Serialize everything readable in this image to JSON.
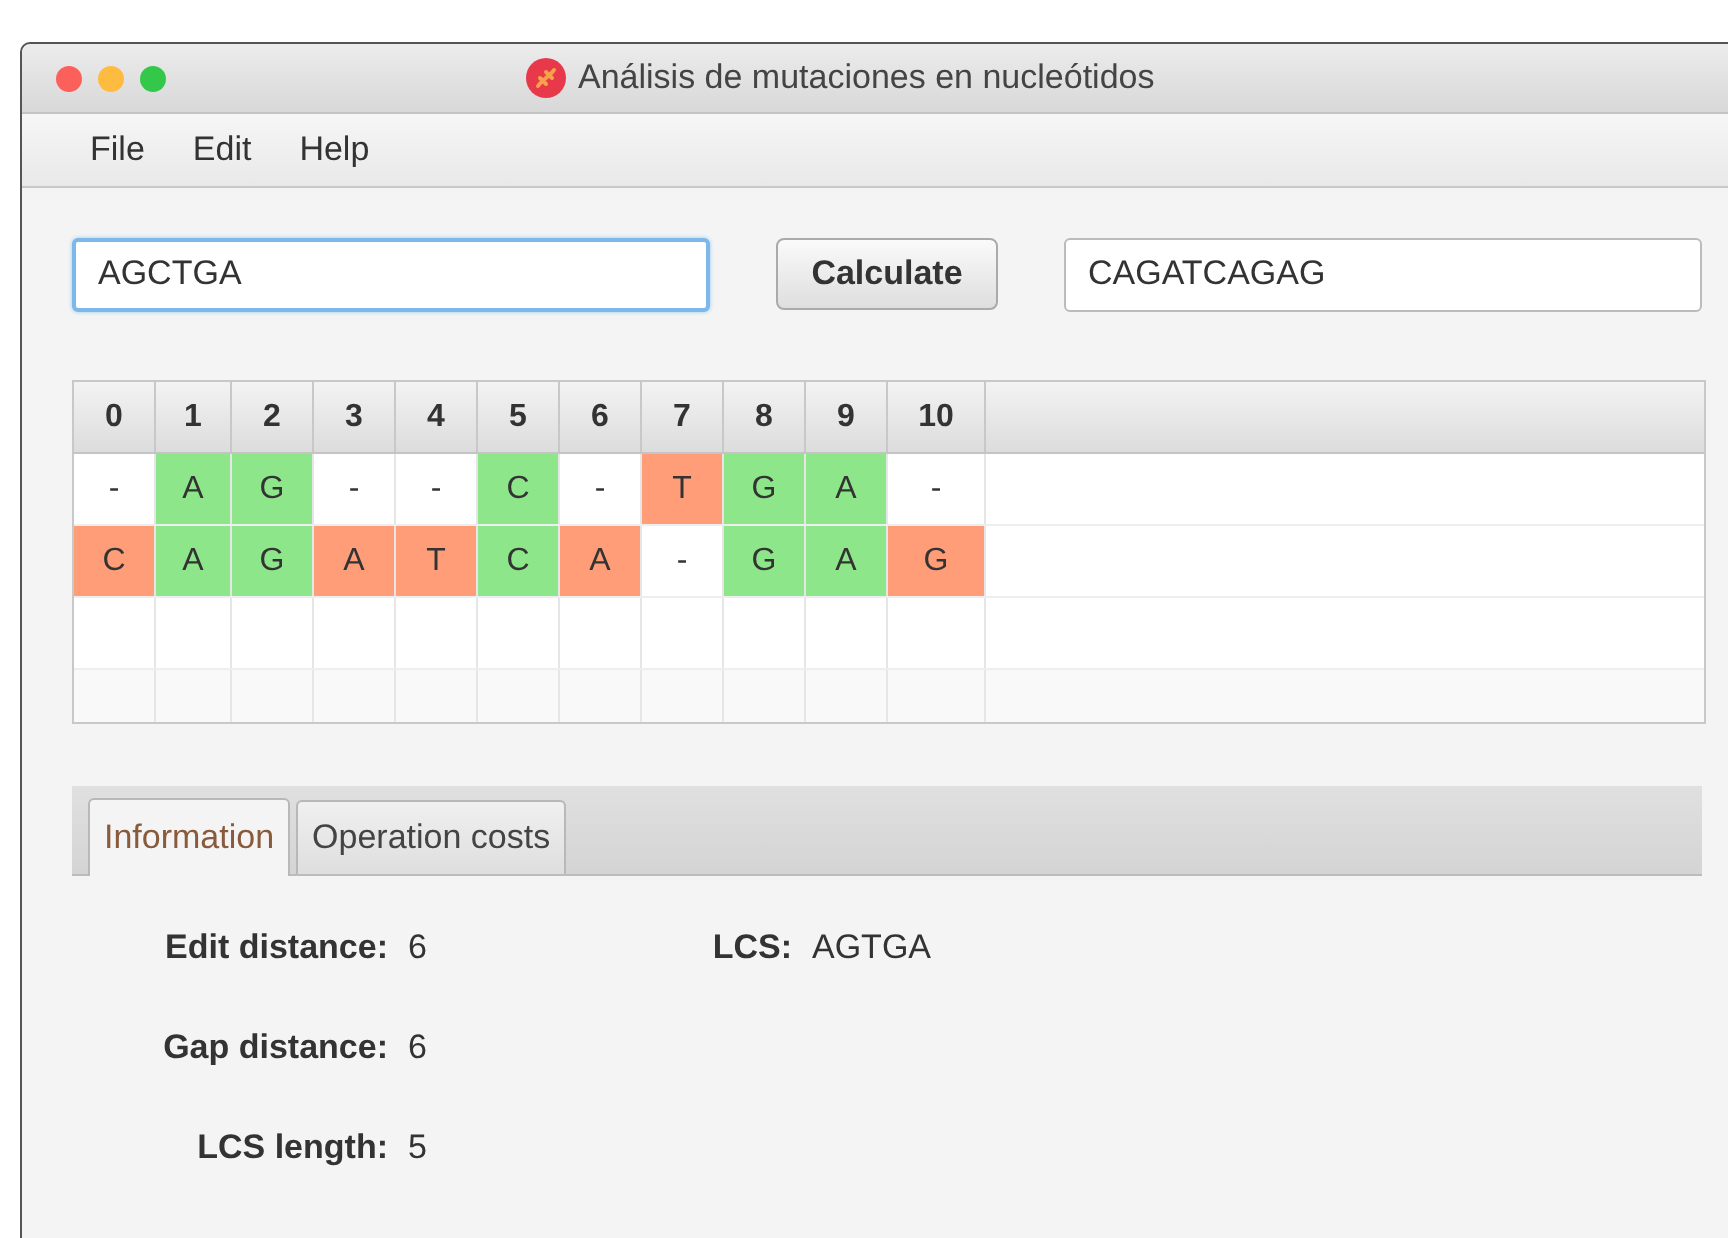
{
  "window": {
    "title": "Análisis de mutaciones en nucleótidos"
  },
  "menu": [
    "File",
    "Edit",
    "Help"
  ],
  "inputs": {
    "left": {
      "value": "AGCTGA",
      "focused": true
    },
    "button": "Calculate",
    "right": {
      "value": "CAGATCAGAG",
      "focused": false
    }
  },
  "table": {
    "columns": [
      "0",
      "1",
      "2",
      "3",
      "4",
      "5",
      "6",
      "7",
      "8",
      "9",
      "10"
    ],
    "rows": [
      [
        {
          "text": "-",
          "kind": "plain"
        },
        {
          "text": "A",
          "kind": "match"
        },
        {
          "text": "G",
          "kind": "match"
        },
        {
          "text": "-",
          "kind": "plain"
        },
        {
          "text": "-",
          "kind": "plain"
        },
        {
          "text": "C",
          "kind": "match"
        },
        {
          "text": "-",
          "kind": "plain"
        },
        {
          "text": "T",
          "kind": "mismatch"
        },
        {
          "text": "G",
          "kind": "match"
        },
        {
          "text": "A",
          "kind": "match"
        },
        {
          "text": "-",
          "kind": "plain"
        }
      ],
      [
        {
          "text": "C",
          "kind": "mismatch"
        },
        {
          "text": "A",
          "kind": "match"
        },
        {
          "text": "G",
          "kind": "match"
        },
        {
          "text": "A",
          "kind": "mismatch"
        },
        {
          "text": "T",
          "kind": "mismatch"
        },
        {
          "text": "C",
          "kind": "match"
        },
        {
          "text": "A",
          "kind": "mismatch"
        },
        {
          "text": "-",
          "kind": "plain"
        },
        {
          "text": "G",
          "kind": "match"
        },
        {
          "text": "A",
          "kind": "match"
        },
        {
          "text": "G",
          "kind": "mismatch"
        }
      ]
    ]
  },
  "tabs": [
    {
      "label": "Information",
      "selected": true
    },
    {
      "label": "Operation costs",
      "selected": false
    }
  ],
  "info": {
    "left": [
      {
        "label": "Edit distance:",
        "value": "6"
      },
      {
        "label": "Gap distance:",
        "value": "6"
      },
      {
        "label": "LCS length:",
        "value": "5"
      }
    ],
    "right": [
      {
        "label": "LCS:",
        "value": "AGTGA"
      }
    ]
  }
}
